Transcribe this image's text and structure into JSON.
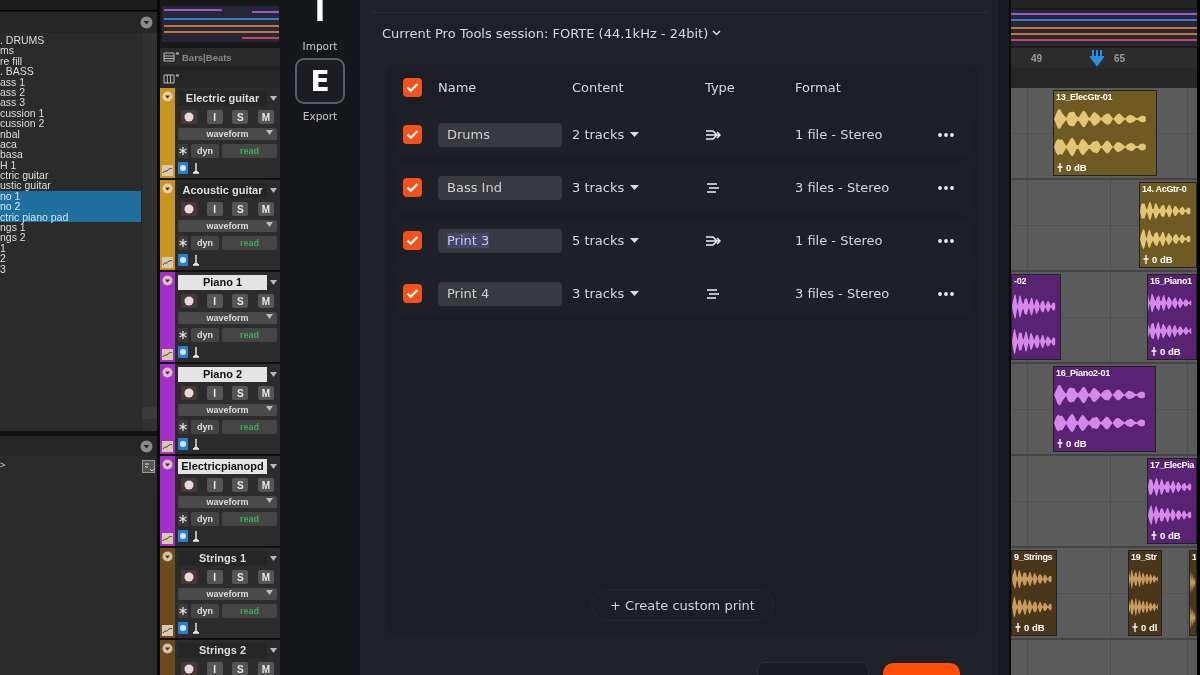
{
  "track_list": {
    "items": [
      {
        "label": ". DRUMS",
        "selected": false
      },
      {
        "label": "ms",
        "selected": false
      },
      {
        "label": "re fill",
        "selected": false
      },
      {
        "label": ". BASS",
        "selected": false
      },
      {
        "label": "ass 1",
        "selected": false
      },
      {
        "label": "ass 2",
        "selected": false
      },
      {
        "label": "ass 3",
        "selected": false
      },
      {
        "label": "cussion 1",
        "selected": false
      },
      {
        "label": "cussion 2",
        "selected": false
      },
      {
        "label": "nbal",
        "selected": false
      },
      {
        "label": "aca",
        "selected": false
      },
      {
        "label": "basa",
        "selected": false
      },
      {
        "label": "H 1",
        "selected": false
      },
      {
        "label": "ctric guitar",
        "selected": false
      },
      {
        "label": "ustic guitar",
        "selected": false
      },
      {
        "label": "no 1",
        "selected": true
      },
      {
        "label": "no 2",
        "selected": true
      },
      {
        "label": "ctric piano pad",
        "selected": true
      },
      {
        "label": "ngs 1",
        "selected": false
      },
      {
        "label": "ngs 2",
        "selected": false
      },
      {
        "label": "1",
        "selected": false
      },
      {
        "label": "2",
        "selected": false
      },
      {
        "label": "3",
        "selected": false
      }
    ]
  },
  "lower_panel": {
    "text": ">"
  },
  "ruler": {
    "timebase": "Bars|Beats"
  },
  "tracks": [
    {
      "name": "Electric guitar",
      "selected": false,
      "color": "#c8961e",
      "buttons": [
        "I",
        "S",
        "M"
      ],
      "view": "waveform",
      "dyn": "dyn",
      "automation": "read"
    },
    {
      "name": "Acoustic guitar",
      "selected": false,
      "color": "#c8961e",
      "buttons": [
        "I",
        "S",
        "M"
      ],
      "view": "waveform",
      "dyn": "dyn",
      "automation": "read"
    },
    {
      "name": "Piano 1",
      "selected": true,
      "color": "#a030c8",
      "buttons": [
        "I",
        "S",
        "M"
      ],
      "view": "waveform",
      "dyn": "dyn",
      "automation": "read"
    },
    {
      "name": "Piano 2",
      "selected": true,
      "color": "#a030c8",
      "buttons": [
        "I",
        "S",
        "M"
      ],
      "view": "waveform",
      "dyn": "dyn",
      "automation": "read"
    },
    {
      "name": "Electricpianopd",
      "selected": true,
      "color": "#a030c8",
      "buttons": [
        "I",
        "S",
        "M"
      ],
      "view": "waveform",
      "dyn": "dyn",
      "automation": "read"
    },
    {
      "name": "Strings 1",
      "selected": false,
      "color": "#6b4a1e",
      "buttons": [
        "I",
        "S",
        "M"
      ],
      "view": "waveform",
      "dyn": "dyn",
      "automation": "read"
    },
    {
      "name": "Strings 2",
      "selected": false,
      "color": "#6b4a1e",
      "buttons": [
        "I",
        "S",
        "M"
      ]
    }
  ],
  "dialog": {
    "nav": [
      {
        "letter": "I",
        "label": "Import",
        "selected": false
      },
      {
        "letter": "E",
        "label": "Export",
        "selected": true
      }
    ],
    "session": "Current Pro Tools session: FORTE (44.1kHz - 24bit)",
    "select_all": true,
    "columns": [
      "Name",
      "Content",
      "Type",
      "Format"
    ],
    "prints": [
      {
        "checked": true,
        "name": "Drums",
        "highlighted": false,
        "content": "2 tracks",
        "kind": "merged",
        "format": "1 file - Stereo"
      },
      {
        "checked": true,
        "name": "Bass Ind",
        "highlighted": false,
        "content": "3 tracks",
        "kind": "split",
        "format": "3 files - Stereo"
      },
      {
        "checked": true,
        "name": "Print 3",
        "highlighted": true,
        "content": "5 tracks",
        "kind": "merged",
        "format": "1 file - Stereo"
      },
      {
        "checked": true,
        "name": "Print 4",
        "highlighted": false,
        "content": "3 tracks",
        "kind": "split",
        "format": "3 files - Stereo"
      }
    ],
    "create_button": "+ Create custom print"
  },
  "timeline": {
    "markers": [
      "49",
      "65"
    ],
    "lanes": [
      {
        "clips": [
          {
            "name": "13_ElecGtr-01",
            "gain": "0 dB"
          }
        ]
      },
      {
        "clips": [
          {
            "name": "14. AcGtr-0",
            "gain": "0 dB"
          }
        ]
      },
      {
        "clips": [
          {
            "name": "-02"
          },
          {
            "name": "15_Piano1",
            "gain": "0 dB"
          }
        ]
      },
      {
        "clips": [
          {
            "name": "16_Piano2-01",
            "gain": "0 dB"
          }
        ]
      },
      {
        "clips": [
          {
            "name": "17_ElecPia",
            "gain": "0 dB"
          }
        ]
      },
      {
        "clips": [
          {
            "name": "9_Strings",
            "gain": "0 dB"
          },
          {
            "name": "19_Str",
            "gain": "0 dl"
          },
          {
            "name": "1"
          }
        ]
      }
    ]
  }
}
